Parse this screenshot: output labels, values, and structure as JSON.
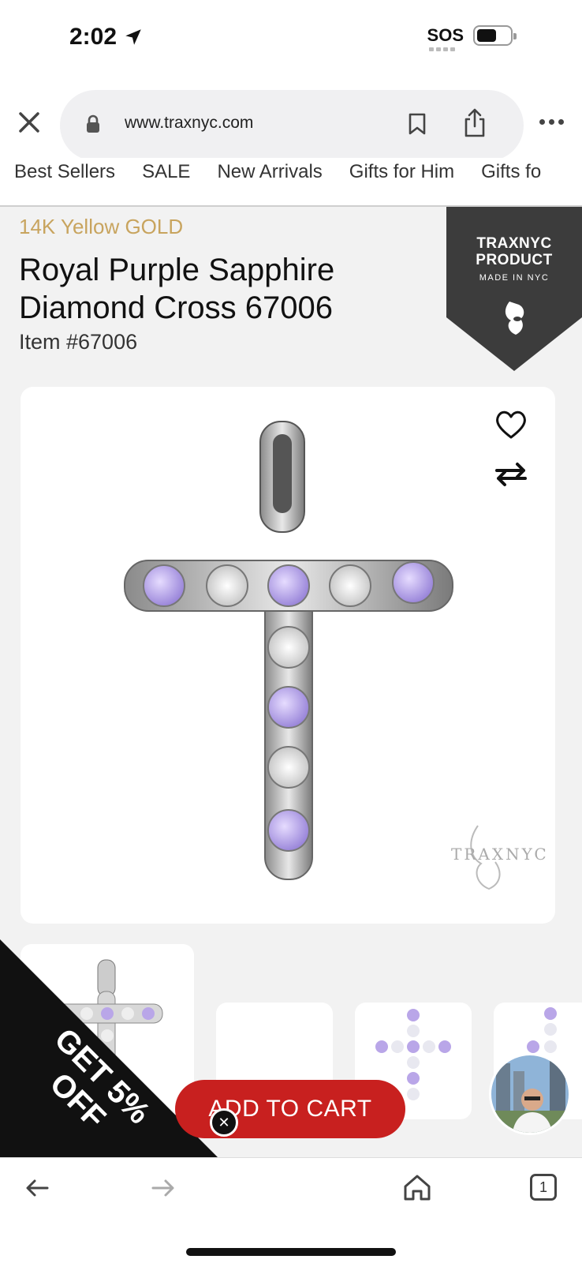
{
  "status_bar": {
    "time": "2:02",
    "sos": "SOS"
  },
  "browser": {
    "url": "www.traxnyc.com",
    "tab_count": "1"
  },
  "nav_menu": {
    "items": [
      "Best Sellers",
      "SALE",
      "New Arrivals",
      "Gifts for Him",
      "Gifts fo"
    ]
  },
  "product": {
    "metal": "14K Yellow GOLD",
    "title": "Royal Purple Sapphire Diamond Cross 67006",
    "item_number": "Item #67006"
  },
  "badge": {
    "brand": "TRAXNYC PRODUCT",
    "tagline": "MADE IN NYC"
  },
  "image": {
    "watermark": "TRAXNYC"
  },
  "promo": {
    "text": "GET 5% OFF"
  },
  "cart": {
    "add_label": "ADD TO CART"
  },
  "colors": {
    "accent": "#c8201f",
    "gold": "#c8a45e",
    "badge": "#3c3c3c",
    "stone_purple": "#b9a6e8"
  }
}
